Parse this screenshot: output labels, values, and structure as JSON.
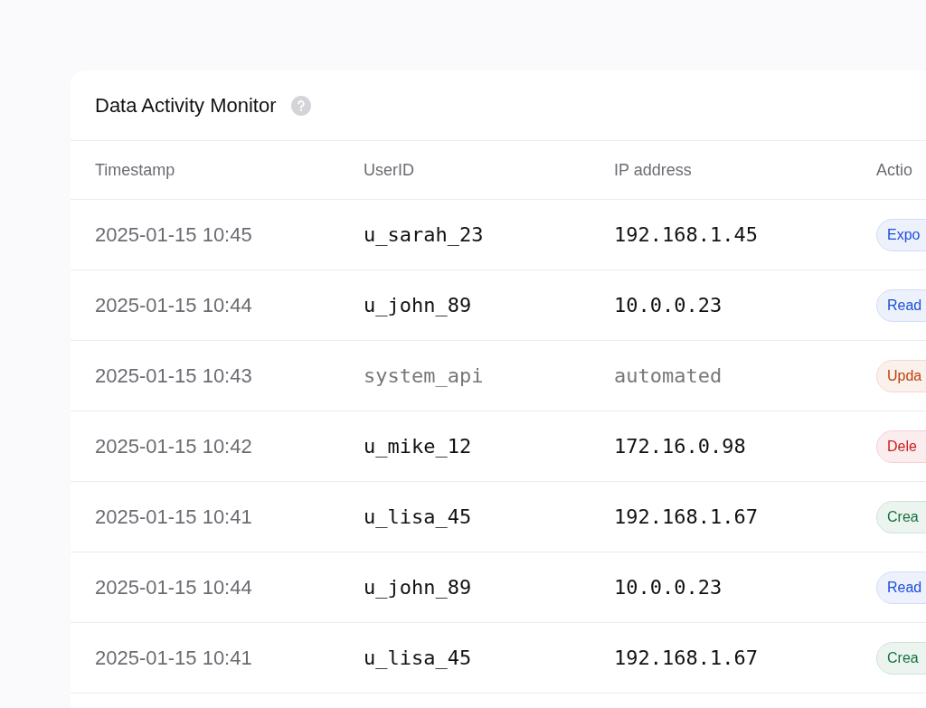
{
  "title": "Data Activity Monitor",
  "table": {
    "columns": [
      "Timestamp",
      "UserID",
      "IP address",
      "Actio"
    ],
    "rows": [
      {
        "timestamp": "2025-01-15 10:45",
        "user": "u_sarah_23",
        "ip": "192.168.1.45",
        "action": "Expo",
        "color": "#1d4ed8",
        "muted": false
      },
      {
        "timestamp": "2025-01-15 10:44",
        "user": "u_john_89",
        "ip": "10.0.0.23",
        "action": "Read",
        "color": "#1d4ed8",
        "muted": false
      },
      {
        "timestamp": "2025-01-15 10:43",
        "user": "system_api",
        "ip": "automated",
        "action": "Upda",
        "color": "#c2410c",
        "muted": true
      },
      {
        "timestamp": "2025-01-15 10:42",
        "user": "u_mike_12",
        "ip": "172.16.0.98",
        "action": "Dele",
        "color": "#c81e1e",
        "muted": false
      },
      {
        "timestamp": "2025-01-15 10:41",
        "user": "u_lisa_45",
        "ip": "192.168.1.67",
        "action": "Crea",
        "color": "#15703d",
        "muted": false
      },
      {
        "timestamp": "2025-01-15 10:44",
        "user": "u_john_89",
        "ip": "10.0.0.23",
        "action": "Read",
        "color": "#1d4ed8",
        "muted": false
      },
      {
        "timestamp": "2025-01-15 10:41",
        "user": "u_lisa_45",
        "ip": "192.168.1.67",
        "action": "Crea",
        "color": "#15703d",
        "muted": false
      }
    ]
  }
}
